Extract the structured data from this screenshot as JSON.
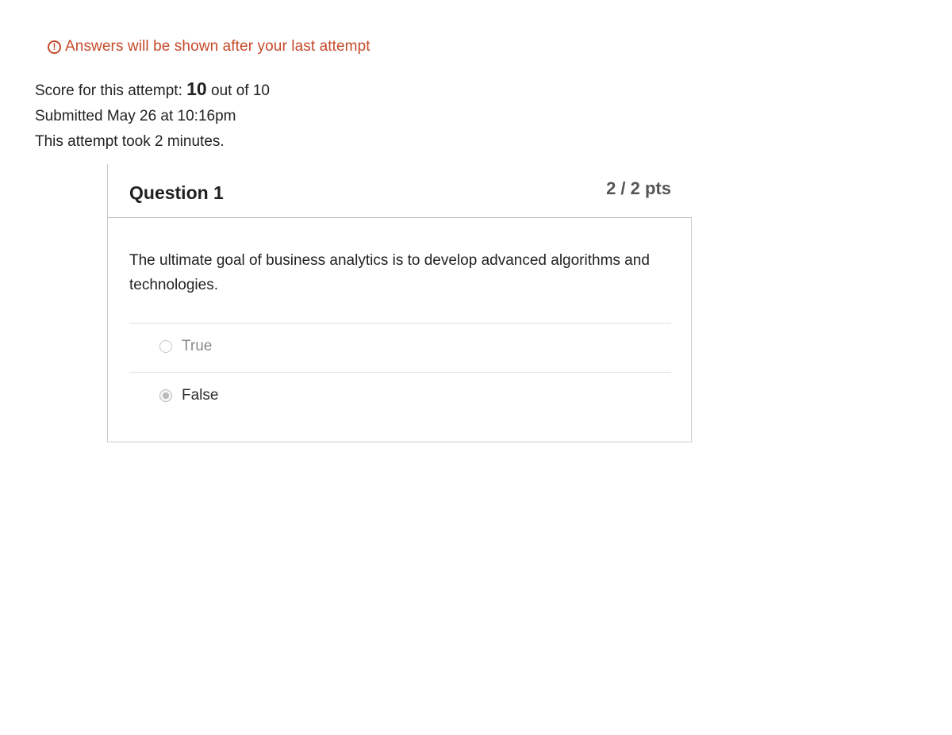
{
  "notice": {
    "icon": "exclamation-circle-icon",
    "text": "Answers will be shown after your last attempt",
    "color": "#c54a2a"
  },
  "summary": {
    "score_prefix": "Score for this attempt: ",
    "score_value": "10",
    "score_suffix": " out of 10",
    "submitted": "Submitted May 26 at 10:16pm",
    "duration": "This attempt took 2 minutes."
  },
  "question": {
    "title": "Question 1",
    "points": "2 / 2 pts",
    "text": "The ultimate goal of business analytics is to develop advanced algorithms and technologies.",
    "answers": [
      {
        "label": "True",
        "selected": false
      },
      {
        "label": "False",
        "selected": true
      }
    ]
  }
}
